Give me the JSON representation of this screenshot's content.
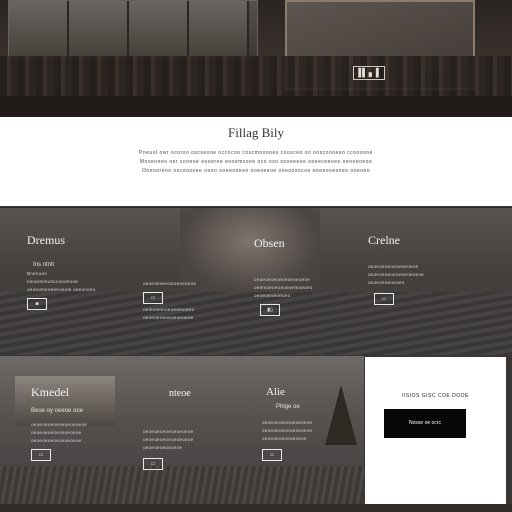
{
  "hero": {
    "tag": "▐▌▖▌"
  },
  "intro": {
    "title": "Fillag Bily",
    "lines": [
      "Pneuol owr ocoroo oscseooe occocoo coscmooooes coosceo oo ooscoooeeo ccoooooe",
      "Mooeoeeo oer cooeoe eooeroe eooemsooe oco oso sooeeeoe ooeeceeoeo oeooeoeoo",
      "Ooeooreoo ooceosoee oeoo ooeeooeeo ooeseeoe ooeoosocoe eoeeooesoeo ooeoeo"
    ]
  },
  "cards_row1": [
    {
      "title": "Dremus",
      "subtitle": "Ins ntnlt",
      "lines": [
        "Bnenuon",
        "nmoemmumoneumnoe",
        "oeoeomeoeeeoeom oeeonoeo"
      ],
      "icon_label": "■"
    },
    {
      "title": "",
      "subtitle": "",
      "lines": [
        "oeoeoeoeeoeoeoeoeoe",
        "oemoeemoeoeemoeeo",
        "oeoeoeoeoeoeoeoeoe"
      ],
      "icon_label": "▭"
    },
    {
      "title": "Obsen",
      "subtitle": "",
      "lines": [
        "oeoeoeoeoeoeoeoeoeoe",
        "oeemoeoeoeoeoemoeoeo",
        "oeoeoeoeoeoeo"
      ],
      "icon_label": "▮▯"
    },
    {
      "title": "Crelne",
      "subtitle": "",
      "lines": [
        "oeoeoeoeoeoeoeoeoe",
        "oeoeoeoeoeoeoeoeoeoe",
        "oeoeoeoeoeoeo"
      ],
      "icon_label": "▭"
    }
  ],
  "cards_row2": [
    {
      "title": "Kmedel",
      "subtitle": "Beoe oy oeeoe ooe",
      "lines": [
        "oeoeoeoeoeoeoeoeoeoe",
        "oeoeoeoeoeoeoeoeoe",
        "oeoeoeoeoeoeoeoeoe"
      ],
      "icon_label": "▭"
    },
    {
      "title": "nteoe",
      "subtitle": "",
      "lines": [
        "oeoeoeoeoeoeoeoeoe",
        "oeoeoeoeoeoeoeoeoe",
        "oeoeoeoeoeoeoe"
      ],
      "icon_label": "▭"
    },
    {
      "title": "Alie",
      "subtitle": "Phlge oe",
      "lines": [
        "oeoeoeoeoeoeoeoeoe",
        "oeoeoeoeoeoeoeoeoe",
        "oeoeoeoeoeoeoeoe"
      ],
      "icon_label": "▭"
    }
  ],
  "cta": {
    "title": "IISIOS GISC COE DOOE",
    "button_label": "Nosse oe ocrc"
  }
}
